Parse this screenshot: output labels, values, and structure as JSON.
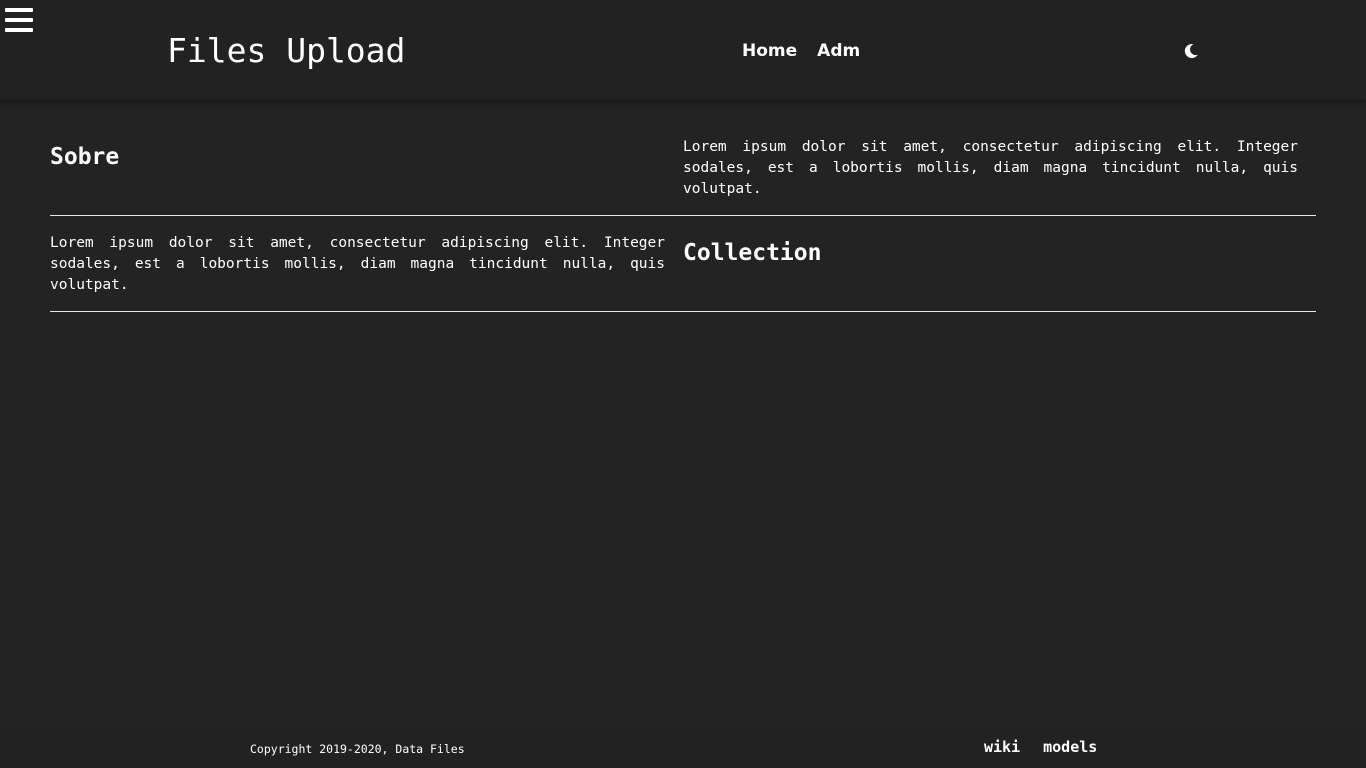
{
  "header": {
    "menu_icon": "hamburger-menu-icon",
    "title": "Files Upload",
    "nav": [
      {
        "label": "Home"
      },
      {
        "label": "Adm"
      }
    ],
    "theme_icon": "moon-icon"
  },
  "sections": [
    {
      "heading": "Sobre",
      "text": "Lorem ipsum dolor sit amet, consectetur adipiscing elit. Integer sodales, est a lobortis mollis, diam magna tincidunt nulla, quis volutpat."
    },
    {
      "heading": "Collection",
      "text": "Lorem ipsum dolor sit amet, consectetur adipiscing elit. Integer sodales, est a lobortis mollis, diam magna tincidunt nulla, quis volutpat."
    }
  ],
  "footer": {
    "copyright": "Copyright 2019-2020, Data Files",
    "links": [
      {
        "label": "wiki"
      },
      {
        "label": "models"
      }
    ]
  },
  "colors": {
    "background": "#232323",
    "header_background": "#222222",
    "text": "#ffffff",
    "divider": "#e6e6e6"
  }
}
